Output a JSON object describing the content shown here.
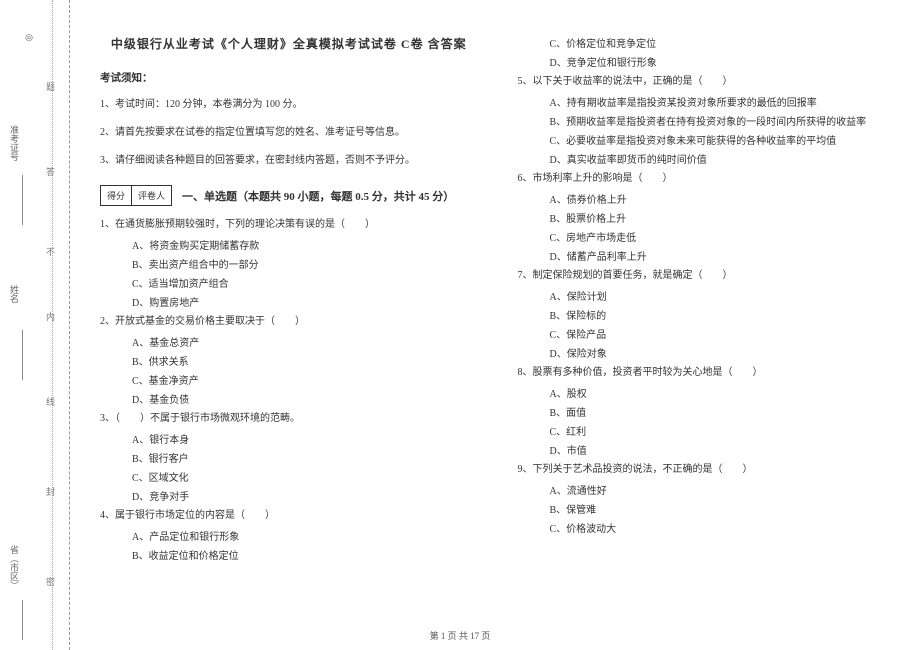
{
  "doc": {
    "title": "中级银行从业考试《个人理财》全真模拟考试试卷 C卷 含答案",
    "notice_header": "考试须知：",
    "notices": [
      "1、考试时间：120 分钟，本卷满分为 100 分。",
      "2、请首先按要求在试卷的指定位置填写您的姓名、准考证号等信息。",
      "3、请仔细阅读各种题目的回答要求，在密封线内答题，否则不予评分。"
    ],
    "score_labels": {
      "score": "得分",
      "reviewer": "评卷人"
    },
    "section_title": "一、单选题（本题共 90 小题，每题 0.5 分，共计 45 分）",
    "binding": {
      "province": "省（市区）",
      "name": "姓名",
      "ticket": "准考证号",
      "seal_chars": [
        "密",
        "封",
        "线",
        "内",
        "不",
        "答",
        "题"
      ]
    },
    "footer": "第 1 页 共 17 页",
    "questions_left": [
      {
        "stem": "1、在通货膨胀预期较强时，下列的理论决策有误的是（　　）",
        "options": [
          "A、将资金购买定期储蓄存款",
          "B、卖出资产组合中的一部分",
          "C、适当增加资产组合",
          "D、购置房地产"
        ]
      },
      {
        "stem": "2、开放式基金的交易价格主要取决于（　　）",
        "options": [
          "A、基金总资产",
          "B、供求关系",
          "C、基金净资产",
          "D、基金负债"
        ]
      },
      {
        "stem": "3、（　　）不属于银行市场微观环境的范畴。",
        "options": [
          "A、银行本身",
          "B、银行客户",
          "C、区域文化",
          "D、竞争对手"
        ]
      },
      {
        "stem": "4、属于银行市场定位的内容是（　　）",
        "options": [
          "A、产品定位和银行形象",
          "B、收益定位和价格定位"
        ]
      }
    ],
    "questions_right_continued_options": [
      "C、价格定位和竞争定位",
      "D、竞争定位和银行形象"
    ],
    "questions_right": [
      {
        "stem": "5、以下关于收益率的说法中，正确的是（　　）",
        "options": [
          "A、持有期收益率是指投资某投资对象所要求的最低的回报率",
          "B、预期收益率是指投资者在持有投资对象的一段时间内所获得的收益率",
          "C、必要收益率是指投资对象未来可能获得的各种收益率的平均值",
          "D、真实收益率即货币的纯时间价值"
        ]
      },
      {
        "stem": "6、市场利率上升的影响是（　　）",
        "options": [
          "A、债券价格上升",
          "B、股票价格上升",
          "C、房地产市场走低",
          "D、储蓄产品利率上升"
        ]
      },
      {
        "stem": "7、制定保险规划的首要任务，就是确定（　　）",
        "options": [
          "A、保险计划",
          "B、保险标的",
          "C、保险产品",
          "D、保险对象"
        ]
      },
      {
        "stem": "8、股票有多种价值，投资者平时较为关心地是（　　）",
        "options": [
          "A、股权",
          "B、面值",
          "C、红利",
          "D、市值"
        ]
      },
      {
        "stem": "9、下列关于艺术品投资的说法，不正确的是（　　）",
        "options": [
          "A、流通性好",
          "B、保管难",
          "C、价格波动大"
        ]
      }
    ]
  }
}
